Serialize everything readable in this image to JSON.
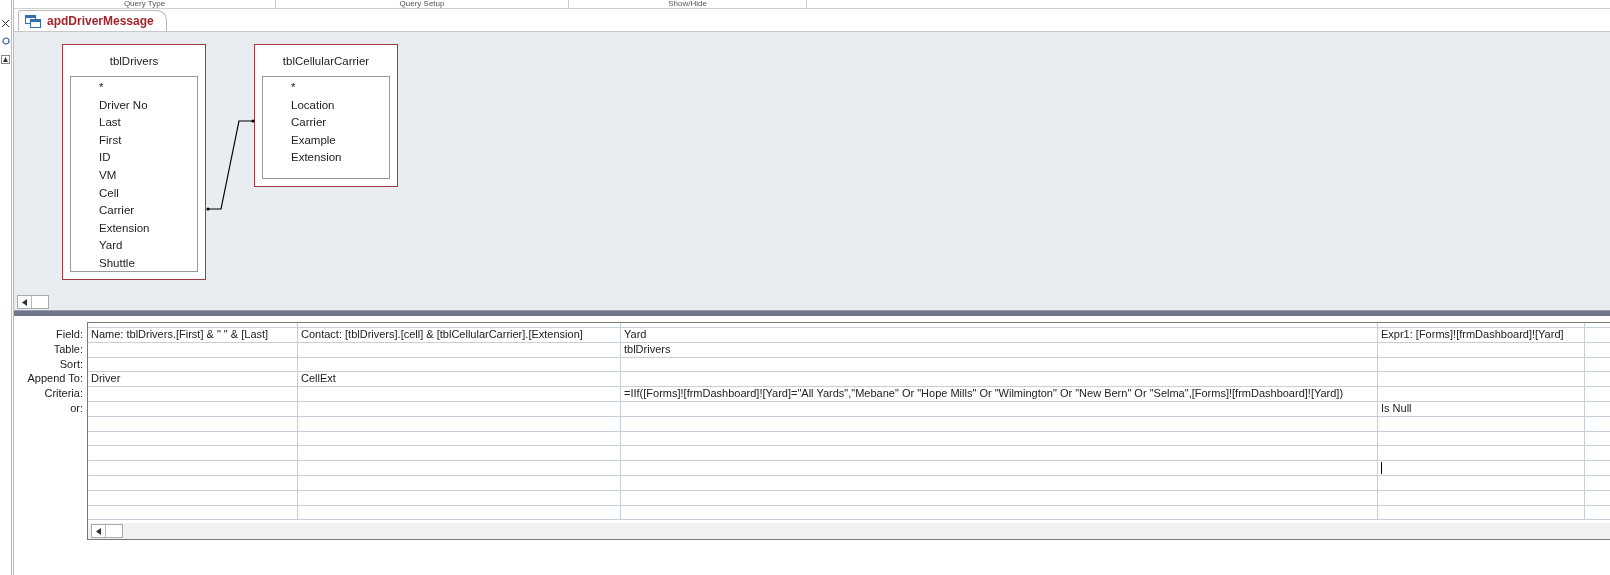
{
  "ribbon_groups": [
    "Query Type",
    "Query Setup",
    "Show/Hide"
  ],
  "document_tab": {
    "label": "apdDriverMessage",
    "selected": true
  },
  "tables": [
    {
      "name": "tblDrivers",
      "fields": [
        "*",
        "Driver No",
        "Last",
        "First",
        "ID",
        "VM",
        "Cell",
        "Carrier",
        "Extension",
        "Yard",
        "Shuttle"
      ]
    },
    {
      "name": "tblCellularCarrier",
      "fields": [
        "*",
        "Location",
        "Carrier",
        "Example",
        "Extension"
      ]
    }
  ],
  "grid": {
    "rows": [
      {
        "label": "Field:",
        "kind": "field"
      },
      {
        "label": "Table:",
        "kind": "table"
      },
      {
        "label": "Sort:",
        "kind": "sort"
      },
      {
        "label": "Append To:",
        "kind": "append_to"
      },
      {
        "label": "Criteria:",
        "kind": "criteria"
      },
      {
        "label": "or:",
        "kind": "or"
      }
    ],
    "columns": [
      {
        "field": "Name: tblDrivers.[First] & \" \" & [Last]",
        "append_to": "Driver"
      },
      {
        "field": "Contact: [tblDrivers].[cell] & [tblCellularCarrier].[Extension]",
        "append_to": "CellExt"
      },
      {
        "field": "Yard",
        "table": "tblDrivers",
        "criteria": "=IIf([Forms]![frmDashboard]![Yard]=\"All Yards\",\"Mebane\" Or \"Hope Mills\" Or \"Wilmington\" Or \"New Bern\" Or \"Selma\",[Forms]![frmDashboard]![Yard])"
      },
      {
        "field": "Expr1: [Forms]![frmDashboard]![Yard]",
        "or": "Is Null",
        "has_cursor": true
      }
    ]
  }
}
